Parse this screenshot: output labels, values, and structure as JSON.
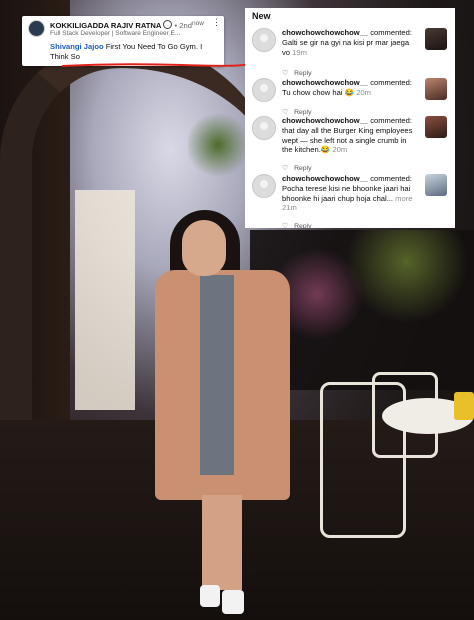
{
  "linkedin_post": {
    "author_name": "KOKKILIGADDA RAJIV RATNA",
    "degree": "• 2nd",
    "time": "now",
    "headline": "Full Stack Developer | Software Engineer E...",
    "mention": "Shivangi Jajoo",
    "comment_text": " First You Need To Go Gym. I Think So"
  },
  "instagram_comments": {
    "header": "New",
    "reply_label": "Reply",
    "items": [
      {
        "username": "chowchowchowchow__",
        "action": " commented:",
        "text": "Galti se gir na gyi na kisi pr mar jaega vo",
        "time": "19m",
        "more": ""
      },
      {
        "username": "chowchowchowchow__",
        "action": " commented:",
        "text": "Tu chow chow hai 😂",
        "time": "20m",
        "more": ""
      },
      {
        "username": "chowchowchowchow__",
        "action": " commented:",
        "text": "that day all the Burger King employees wept — she left not a single crumb in the kitchen.😂",
        "time": "20m",
        "more": ""
      },
      {
        "username": "chowchowchowchow__",
        "action": " commented:",
        "text": "Pocha terese kisi ne bhoonke jaari hai bhoonke hi jaari chup hoja chal...",
        "time": "21m",
        "more": "more"
      }
    ]
  },
  "colors": {
    "mention_blue": "#1c5cbf",
    "underline_red": "#e0221a",
    "meta_gray": "#8e8e8e"
  }
}
